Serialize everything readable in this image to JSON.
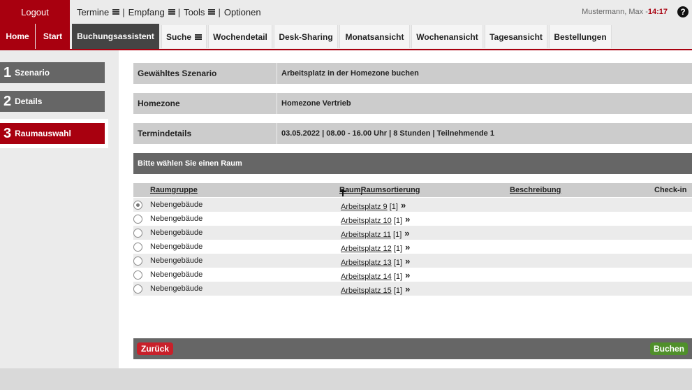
{
  "topbar": {
    "logout": "Logout",
    "menu": [
      {
        "label": "Termine",
        "has_menu": true
      },
      {
        "label": "Empfang",
        "has_menu": true
      },
      {
        "label": "Tools",
        "has_menu": true
      },
      {
        "label": "Optionen",
        "has_menu": false
      }
    ],
    "user": "Mustermann, Max - ",
    "time": "14:17",
    "help": "?"
  },
  "nav": {
    "home": "Home",
    "start": "Start",
    "booking_assistant": "Buchungsassistent",
    "search": "Suche",
    "week_detail": "Wochendetail",
    "desk_sharing": "Desk-Sharing",
    "month_view": "Monatsansicht",
    "week_view": "Wochenansicht",
    "day_view": "Tagesansicht",
    "orders": "Bestellungen"
  },
  "steps": [
    {
      "num": "1",
      "label": "Szenario"
    },
    {
      "num": "2",
      "label": "Details"
    },
    {
      "num": "3",
      "label": "Raumauswahl"
    }
  ],
  "info": {
    "scenario_label": "Gewähltes Szenario",
    "scenario_value": "Arbeitsplatz in der Homezone buchen",
    "homezone_label": "Homezone",
    "homezone_value": "Homezone Vertrieb",
    "details_label": "Termindetails",
    "details_value": "03.05.2022 | 08.00 - 16.00 Uhr | 8 Stunden | Teilnehmende 1"
  },
  "choose_header": "Bitte wählen Sie einen Raum",
  "table": {
    "col_group": "Raumgruppe",
    "col_room": "Raum",
    "col_sep": " / ",
    "col_sort": "Raumsortierung",
    "col_desc": "Beschreibung",
    "col_checkin": "Check-in",
    "rows": [
      {
        "group": "Nebengebäude",
        "room": "Arbeitsplatz 9",
        "count": "[1]",
        "selected": true
      },
      {
        "group": "Nebengebäude",
        "room": "Arbeitsplatz 10",
        "count": "[1]",
        "selected": false
      },
      {
        "group": "Nebengebäude",
        "room": "Arbeitsplatz 11",
        "count": "[1]",
        "selected": false
      },
      {
        "group": "Nebengebäude",
        "room": "Arbeitsplatz 12",
        "count": "[1]",
        "selected": false
      },
      {
        "group": "Nebengebäude",
        "room": "Arbeitsplatz 13",
        "count": "[1]",
        "selected": false
      },
      {
        "group": "Nebengebäude",
        "room": "Arbeitsplatz 14",
        "count": "[1]",
        "selected": false
      },
      {
        "group": "Nebengebäude",
        "room": "Arbeitsplatz 15",
        "count": "[1]",
        "selected": false
      }
    ]
  },
  "footer": {
    "back": "Zurück",
    "book": "Buchen"
  },
  "colors": {
    "brand": "#a8000f",
    "dark_gray": "#666666",
    "book_green": "#4f8f2a"
  },
  "icons": {
    "menu": "hamburger-icon",
    "help": "help-icon",
    "details": "double-chevron-right-icon",
    "sort": "arrow-up-icon"
  }
}
